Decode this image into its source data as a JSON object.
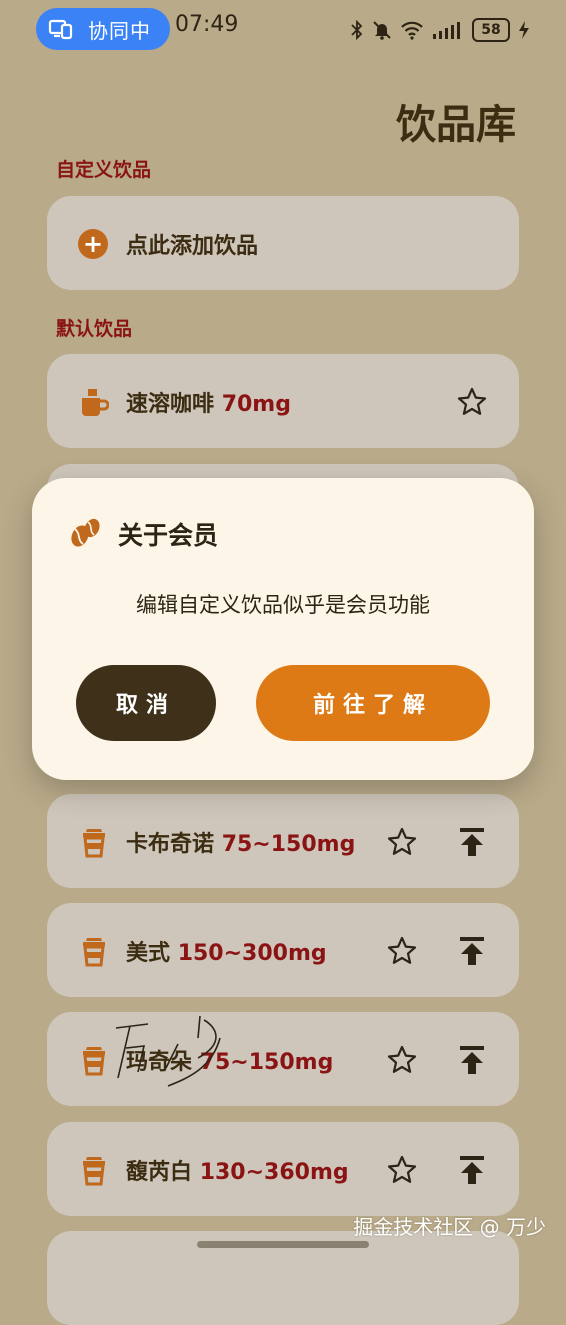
{
  "status_bar": {
    "collab_label": "协同中",
    "time": "07:49",
    "battery": "58",
    "icons": [
      "bluetooth-icon",
      "mute-icon",
      "wifi-icon",
      "signal-icon",
      "battery-icon",
      "charging-icon"
    ]
  },
  "page": {
    "title": "饮品库"
  },
  "sections": {
    "custom_label": "自定义饮品",
    "default_label": "默认饮品"
  },
  "add_card": {
    "label": "点此添加饮品"
  },
  "drinks": [
    {
      "name": "速溶咖啡",
      "caffeine": "70mg"
    },
    {
      "name": "卡布奇诺",
      "caffeine": "75~150mg"
    },
    {
      "name": "美式",
      "caffeine": "150~300mg"
    },
    {
      "name": "玛奇朵",
      "caffeine": "75~150mg"
    },
    {
      "name": "馥芮白",
      "caffeine": "130~360mg"
    }
  ],
  "dialog": {
    "title": "关于会员",
    "message": "编辑自定义饮品似乎是会员功能",
    "cancel_label": "取消",
    "confirm_label": "前往了解"
  },
  "watermark": "掘金技术社区 @ 万少",
  "colors": {
    "background": "#b9aa89",
    "card": "#cec6ba",
    "accent_orange": "#dd7a16",
    "dark_brown": "#3e3019",
    "section_red": "#8a1414",
    "dialog_bg": "#fdf5e8",
    "collab_blue": "#3b82f6"
  }
}
